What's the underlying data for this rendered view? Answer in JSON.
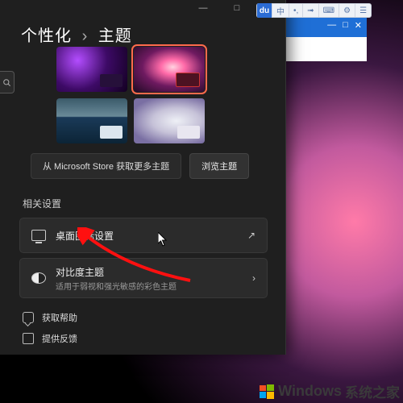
{
  "breadcrumb": {
    "parent": "个性化",
    "sep": "›",
    "current": "主题"
  },
  "themes": {
    "items": [
      {
        "name": "theme-purple"
      },
      {
        "name": "theme-pink",
        "selected": true
      },
      {
        "name": "theme-teal"
      },
      {
        "name": "theme-light"
      }
    ]
  },
  "store": {
    "link_label": "从 Microsoft Store 获取更多主题",
    "browse_label": "浏览主题"
  },
  "section": {
    "related_label": "相关设置"
  },
  "rows": {
    "desktop_icons": {
      "title": "桌面图标设置",
      "trail_icon": "open-icon"
    },
    "contrast": {
      "title": "对比度主题",
      "subtitle": "适用于弱视和强光敏感的彩色主题",
      "trail_icon": "chevron-right-icon"
    }
  },
  "footer": {
    "help": "获取帮助",
    "feedback": "提供反馈"
  },
  "titlebar": {
    "min": "—",
    "max": "□",
    "close": "✕"
  },
  "explorer": {
    "min": "—",
    "max": "□",
    "close": "✕"
  },
  "ime": {
    "logo": "du",
    "cells": [
      "中",
      "•,",
      "➟",
      "⌨",
      "⚙",
      "☰"
    ]
  },
  "watermark": {
    "brand": "Windows",
    "suffix": "系统之家"
  }
}
